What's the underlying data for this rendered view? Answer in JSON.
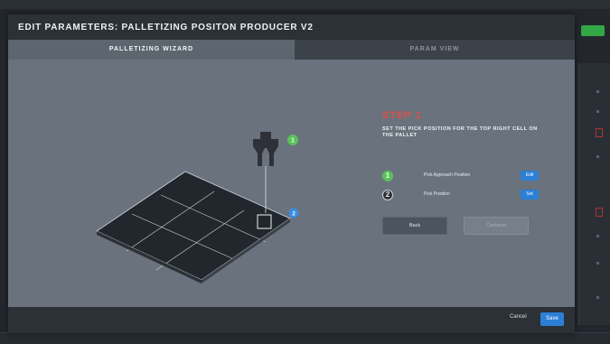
{
  "modal": {
    "title": "EDIT PARAMETERS: PALLETIZING POSITON PRODUCER V2",
    "tabs": [
      {
        "label": "PALLETIZING WIZARD",
        "active": true
      },
      {
        "label": "PARAM VIEW",
        "active": false
      }
    ],
    "wizard": {
      "step_title": "STEP 1",
      "step_description": "SET THE PICK POSITION FOR THE TOP RIGHT CELL ON THE PALLET",
      "steps": [
        {
          "number": "1",
          "label": "Pick Approach Position",
          "button": "Edit",
          "status_color": "#5cc05c"
        },
        {
          "number": "2",
          "label": "Pick Position",
          "button": "Set",
          "status_color": "#2c3035"
        }
      ],
      "back_label": "Back",
      "continue_label": "Continue",
      "diagram_markers": {
        "approach": "1",
        "pick": "2"
      },
      "pallet_grid": {
        "rows": 3,
        "cols": 3
      }
    },
    "footer": {
      "cancel_label": "Cancel",
      "save_label": "Save"
    }
  },
  "colors": {
    "accent_blue": "#2b7fd6",
    "step_red": "#e04e43",
    "success_green": "#5cc05c"
  }
}
